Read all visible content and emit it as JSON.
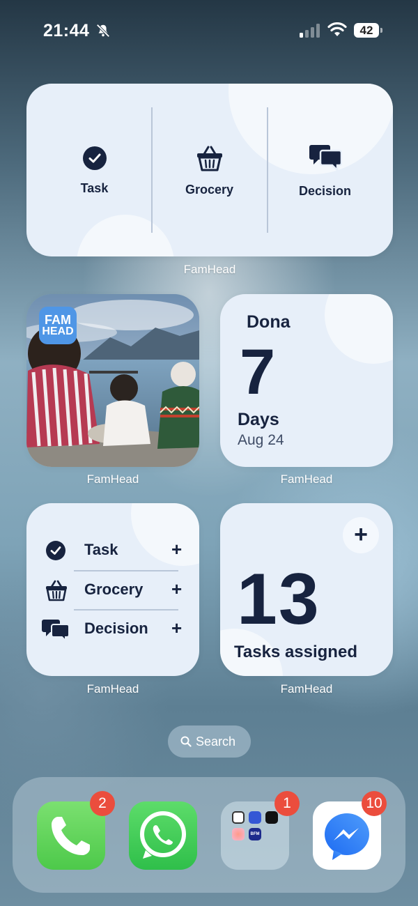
{
  "status_bar": {
    "time": "21:44",
    "battery": "42"
  },
  "widgets": {
    "actions_wide": {
      "items": [
        {
          "label": "Task",
          "icon": "check-circle-icon"
        },
        {
          "label": "Grocery",
          "icon": "basket-icon"
        },
        {
          "label": "Decision",
          "icon": "chat-bubbles-icon"
        }
      ],
      "caption": "FamHead"
    },
    "photo": {
      "logo_line1": "FAM",
      "logo_line2": "HEAD",
      "caption": "FamHead"
    },
    "countdown": {
      "name": "Dona",
      "number": "7",
      "unit": "Days",
      "date": "Aug 24",
      "caption": "FamHead"
    },
    "list": {
      "items": [
        {
          "label": "Task",
          "icon": "check-circle-icon",
          "action": "+"
        },
        {
          "label": "Grocery",
          "icon": "basket-icon",
          "action": "+"
        },
        {
          "label": "Decision",
          "icon": "chat-bubbles-icon",
          "action": "+"
        }
      ],
      "caption": "FamHead"
    },
    "tasks": {
      "plus": "+",
      "number": "13",
      "label": "Tasks assigned",
      "caption": "FamHead"
    }
  },
  "search": {
    "label": "Search"
  },
  "dock": {
    "phone": {
      "badge": "2"
    },
    "whatsapp": {
      "badge": ""
    },
    "folder": {
      "badge": "1",
      "mini_label": "BFM"
    },
    "messenger": {
      "badge": "10"
    }
  },
  "colors": {
    "widget_bg": "#e7eff9",
    "widget_text": "#17233f",
    "badge": "#eb4d3d",
    "phone_green": "#5fd35d",
    "whatsapp_green": "#3ec553",
    "messenger_blue": "#3b74f1"
  }
}
